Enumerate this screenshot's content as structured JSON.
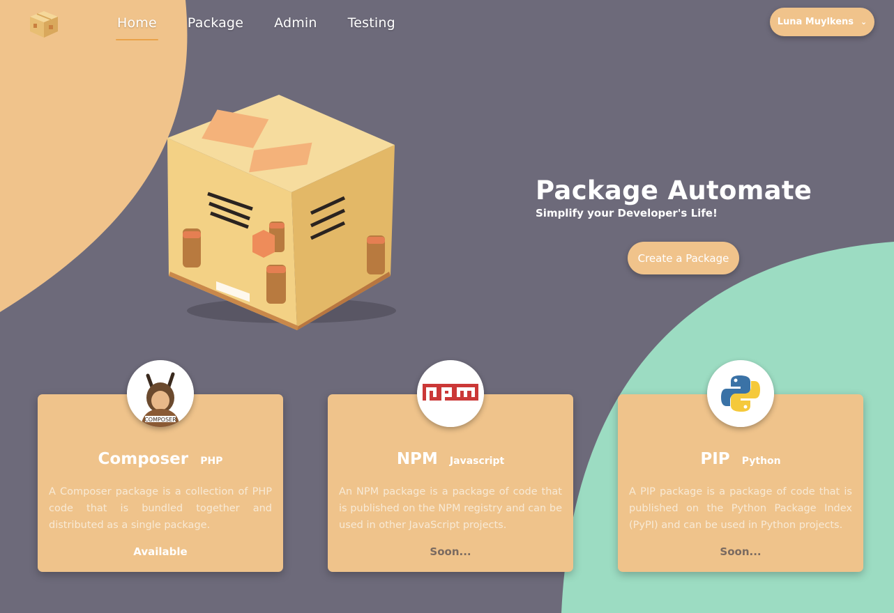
{
  "colors": {
    "background": "#6d6a7a",
    "accent": "#f0c38b",
    "mint": "#9cdcc2",
    "nav_underline": "#e9a24a"
  },
  "nav": {
    "logo": "package-box-icon",
    "items": [
      {
        "label": "Home",
        "active": true
      },
      {
        "label": "Package",
        "active": false
      },
      {
        "label": "Admin",
        "active": false
      },
      {
        "label": "Testing",
        "active": false
      }
    ]
  },
  "user_menu": {
    "name": "Luna Muylkens",
    "icon": "chevron-down-icon"
  },
  "hero": {
    "title": "Package Automate",
    "subtitle": "Simplify your Developer's Life!",
    "cta_label": "Create a Package",
    "image": "cardboard-box-illustration"
  },
  "cards": [
    {
      "name": "Composer",
      "language": "PHP",
      "icon": "composer-logo-icon",
      "description": "A Composer package is a collection of PHP code that is bundled together and distributed as a single package.",
      "status": "Available"
    },
    {
      "name": "NPM",
      "language": "Javascript",
      "icon": "npm-logo-icon",
      "description": "An NPM package is a package of code that is published on the NPM registry and can be used in other JavaScript projects.",
      "status": "Soon..."
    },
    {
      "name": "PIP",
      "language": "Python",
      "icon": "python-logo-icon",
      "description": "A PIP package is a package of code that is published on the Python Package Index (PyPI) and can be used in Python projects.",
      "status": "Soon..."
    }
  ]
}
